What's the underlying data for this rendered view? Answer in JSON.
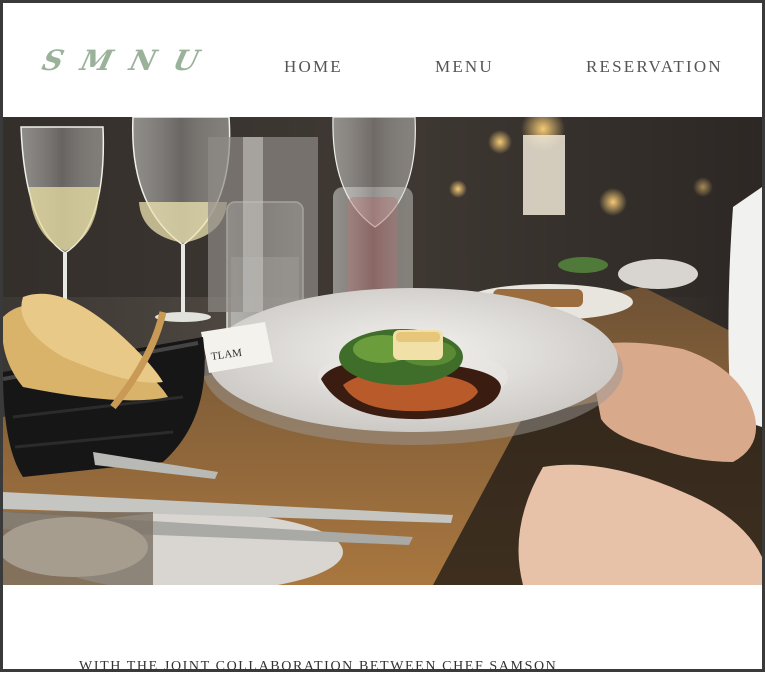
{
  "brand": {
    "logo_text": "SMNU"
  },
  "nav": {
    "home": "HOME",
    "menu": "MENU",
    "reservation": "RESERVATION"
  },
  "hero": {
    "image_alt": "Plated dish on a restaurant dining table",
    "place_card_text": "TLAM"
  },
  "intro": {
    "text": "WITH THE JOINT COLLABORATION BETWEEN CHEF SAMSON"
  },
  "colors": {
    "logo": "#9bb29a",
    "nav_text": "#555555",
    "frame": "#3a3a3a"
  }
}
